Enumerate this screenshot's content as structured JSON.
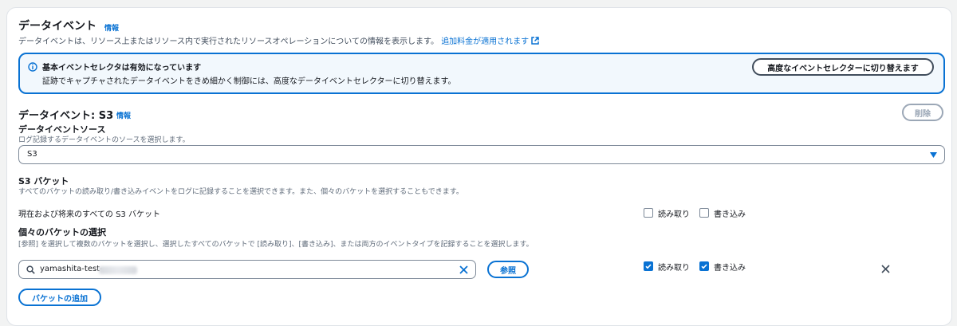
{
  "section": {
    "title": "データイベント",
    "info_label": "情報",
    "description": "データイベントは、リソース上またはリソース内で実行されたリソースオペレーションについての情報を表示します。",
    "pricing_link": "追加料金が適用されます"
  },
  "alert": {
    "title": "基本イベントセレクタは有効になっています",
    "body": "証跡でキャプチャされたデータイベントをきめ細かく制御には、高度なデータイベントセレクターに切り替えます。",
    "switch_button": "高度なイベントセレクターに切り替えます"
  },
  "data_event": {
    "title": "データイベント: S3",
    "info_label": "情報",
    "remove_button": "削除",
    "source_label": "データイベントソース",
    "source_description": "ログ記録するデータイベントのソースを選択します。",
    "source_value": "S3"
  },
  "s3_buckets": {
    "label": "S3 バケット",
    "description": "すべてのバケットの読み取り/書き込みイベントをログに記録することを選択できます。また、個々のバケットを選択することもできます。",
    "all_buckets_label": "現在および将来のすべての S3 バケット",
    "all_read_label": "読み取り",
    "all_write_label": "書き込み",
    "all_read_checked": false,
    "all_write_checked": false
  },
  "individual": {
    "label": "個々のバケットの選択",
    "description": "[参照] を選択して複数のバケットを選択し、選択したすべてのバケットで [読み取り]、[書き込み]、または両方のイベントタイプを記録することを選択します。",
    "search_value": "yamashita-test-",
    "browse_button": "参照",
    "read_label": "読み取り",
    "write_label": "書き込み",
    "read_checked": true,
    "write_checked": true,
    "add_bucket_button": "バケットの追加"
  },
  "colors": {
    "accent": "#0972d3",
    "alert_bg": "#f2f8fd",
    "text": "#16191f",
    "muted": "#5f6b7a"
  }
}
